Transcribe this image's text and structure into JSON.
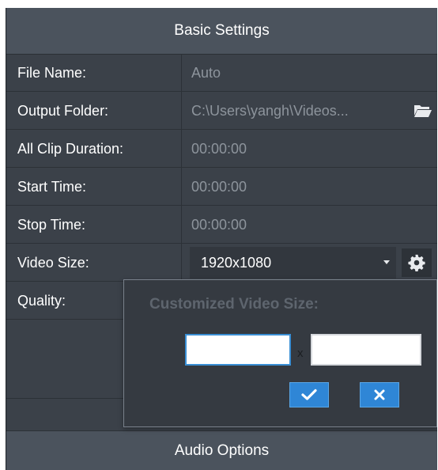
{
  "header": {
    "title": "Basic Settings"
  },
  "rows": [
    {
      "label": "File Name:",
      "value": "Auto"
    },
    {
      "label": "Output Folder:",
      "value": "C:\\Users\\yangh\\Videos..."
    },
    {
      "label": "All Clip Duration:",
      "value": "00:00:00"
    },
    {
      "label": "Start Time:",
      "value": "00:00:00"
    },
    {
      "label": "Stop Time:",
      "value": "00:00:00"
    },
    {
      "label": "Video Size:",
      "value": "1920x1080"
    },
    {
      "label": "Quality:",
      "value": ""
    }
  ],
  "popup": {
    "title": "Customized Video Size:",
    "width_value": "",
    "height_value": "",
    "separator": "x",
    "ok_icon": "checkmark-icon",
    "cancel_icon": "close-icon"
  },
  "footer": {
    "title": "Audio Options"
  },
  "colors": {
    "panel_bg": "#3b4149",
    "header_bg": "#4b535d",
    "accent_blue": "#2f86d6",
    "muted_text": "#8d949c"
  },
  "icons": {
    "output_folder": "folder-open-icon",
    "video_size_settings": "gear-icon",
    "dropdown": "caret-down-icon"
  }
}
